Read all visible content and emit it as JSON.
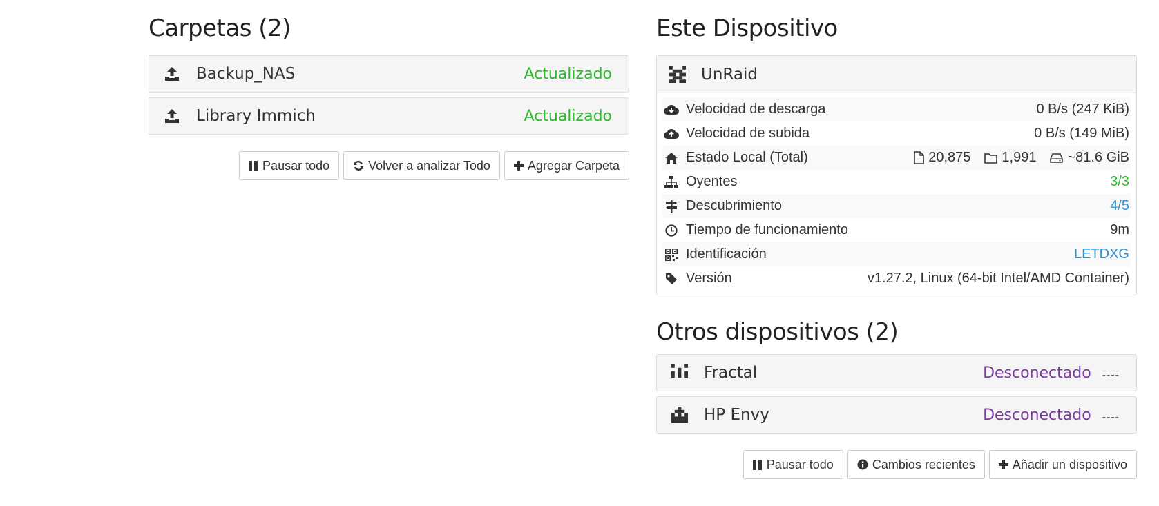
{
  "folders": {
    "heading": "Carpetas (2)",
    "items": [
      {
        "name": "Backup_NAS",
        "status": "Actualizado"
      },
      {
        "name": "Library Immich",
        "status": "Actualizado"
      }
    ],
    "buttons": {
      "pause_all": "Pausar todo",
      "rescan_all": "Volver a analizar Todo",
      "add_folder": "Agregar Carpeta"
    }
  },
  "this_device": {
    "heading": "Este Dispositivo",
    "name": "UnRaid",
    "stats": {
      "download_label": "Velocidad de descarga",
      "download_value": "0 B/s (247 KiB)",
      "upload_label": "Velocidad de subida",
      "upload_value": "0 B/s (149 MiB)",
      "local_state_label": "Estado Local (Total)",
      "local_files": "20,875",
      "local_dirs": "1,991",
      "local_size": "~81.6 GiB",
      "listeners_label": "Oyentes",
      "listeners_value": "3/3",
      "discovery_label": "Descubrimiento",
      "discovery_value": "4/5",
      "uptime_label": "Tiempo de funcionamiento",
      "uptime_value": "9m",
      "id_label": "Identificación",
      "id_value": "LETDXG",
      "version_label": "Versión",
      "version_value": "v1.27.2, Linux (64-bit Intel/AMD Container)"
    }
  },
  "other_devices": {
    "heading": "Otros dispositivos (2)",
    "items": [
      {
        "name": "Fractal",
        "status": "Desconectado",
        "dash": "----"
      },
      {
        "name": "HP Envy",
        "status": "Desconectado",
        "dash": "----"
      }
    ],
    "buttons": {
      "pause_all": "Pausar todo",
      "recent_changes": "Cambios recientes",
      "add_device": "Añadir un dispositivo"
    }
  },
  "colors": {
    "up_to_date": "#2eb82e",
    "disconnected": "#7a3aa0",
    "link": "#2f93d0"
  },
  "icons": {
    "folder": "upload-icon",
    "this_device": "identicon-icon",
    "download": "cloud-download-icon",
    "upload": "cloud-upload-icon",
    "local_state": "home-icon",
    "listeners": "sitemap-icon",
    "discovery": "signpost-icon",
    "uptime": "clock-icon",
    "id": "qrcode-icon",
    "version": "tag-icon"
  }
}
